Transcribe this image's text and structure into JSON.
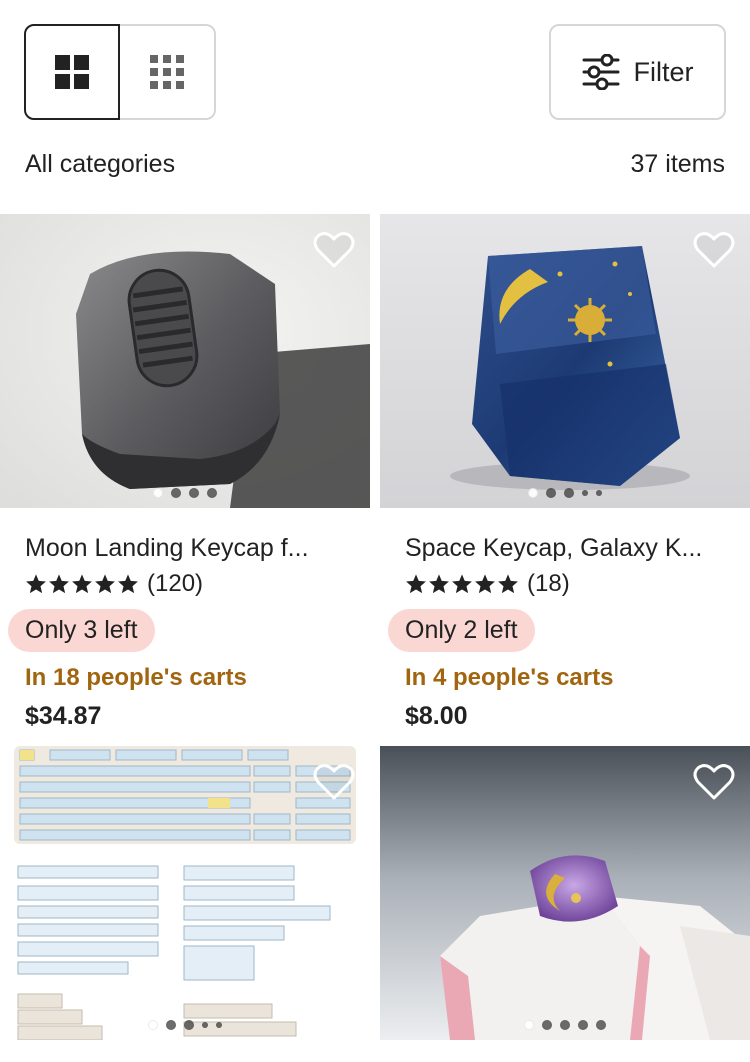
{
  "toolbar": {
    "filter_label": "Filter",
    "large_grid_icon": "grid-large-icon",
    "small_grid_icon": "grid-small-icon",
    "filter_icon": "sliders-icon"
  },
  "summary": {
    "category": "All categories",
    "count": "37 items"
  },
  "listings": [
    {
      "title": "Moon Landing Keycap f...",
      "reviews": "(120)",
      "stars": 5,
      "stock": "Only 3 left",
      "carts": "In 18 people's carts",
      "price": "$34.87"
    },
    {
      "title": "Space Keycap, Galaxy K...",
      "reviews": "(18)",
      "stars": 5,
      "stock": "Only 2 left",
      "carts": "In 4 people's carts",
      "price": "$8.00"
    }
  ],
  "colors": {
    "carts_text": "#a2650f",
    "stock_badge_bg": "#fbd7d4",
    "text": "#222222",
    "border": "#d6d6d6"
  }
}
